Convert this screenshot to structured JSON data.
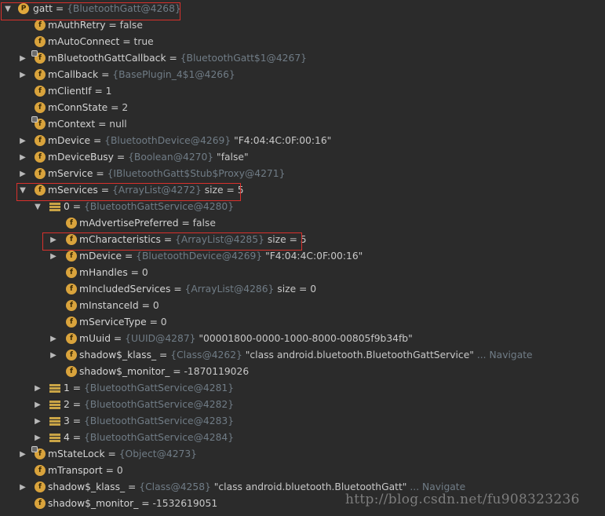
{
  "rows": [
    {
      "name": "gatt",
      "eq": " = ",
      "ref": "{BluetoothGatt@4268}",
      "val": "",
      "nav": ""
    },
    {
      "name": "mAuthRetry",
      "eq": " = ",
      "ref": "",
      "val": "false",
      "nav": ""
    },
    {
      "name": "mAutoConnect",
      "eq": " = ",
      "ref": "",
      "val": "true",
      "nav": ""
    },
    {
      "name": "mBluetoothGattCallback",
      "eq": " = ",
      "ref": "{BluetoothGatt$1@4267}",
      "val": "",
      "nav": ""
    },
    {
      "name": "mCallback",
      "eq": " = ",
      "ref": "{BasePlugin_4$1@4266}",
      "val": "",
      "nav": ""
    },
    {
      "name": "mClientIf",
      "eq": " = ",
      "ref": "",
      "val": "1",
      "nav": ""
    },
    {
      "name": "mConnState",
      "eq": " = ",
      "ref": "",
      "val": "2",
      "nav": ""
    },
    {
      "name": "mContext",
      "eq": " = ",
      "ref": "",
      "val": "null",
      "nav": ""
    },
    {
      "name": "mDevice",
      "eq": " = ",
      "ref": "{BluetoothDevice@4269}",
      "val": " \"F4:04:4C:0F:00:16\"",
      "nav": ""
    },
    {
      "name": "mDeviceBusy",
      "eq": " = ",
      "ref": "{Boolean@4270}",
      "val": " \"false\"",
      "nav": ""
    },
    {
      "name": "mService",
      "eq": " = ",
      "ref": "{IBluetoothGatt$Stub$Proxy@4271}",
      "val": "",
      "nav": ""
    },
    {
      "name": "mServices",
      "eq": " = ",
      "ref": "{ArrayList@4272}",
      "val": "  size = 5",
      "nav": ""
    },
    {
      "name": "0",
      "eq": " = ",
      "ref": "{BluetoothGattService@4280}",
      "val": "",
      "nav": ""
    },
    {
      "name": "mAdvertisePreferred",
      "eq": " = ",
      "ref": "",
      "val": "false",
      "nav": ""
    },
    {
      "name": "mCharacteristics",
      "eq": " = ",
      "ref": "{ArrayList@4285}",
      "val": "  size = 5",
      "nav": ""
    },
    {
      "name": "mDevice",
      "eq": " = ",
      "ref": "{BluetoothDevice@4269}",
      "val": " \"F4:04:4C:0F:00:16\"",
      "nav": ""
    },
    {
      "name": "mHandles",
      "eq": " = ",
      "ref": "",
      "val": "0",
      "nav": ""
    },
    {
      "name": "mIncludedServices",
      "eq": " = ",
      "ref": "{ArrayList@4286}",
      "val": "  size = 0",
      "nav": ""
    },
    {
      "name": "mInstanceId",
      "eq": " = ",
      "ref": "",
      "val": "0",
      "nav": ""
    },
    {
      "name": "mServiceType",
      "eq": " = ",
      "ref": "",
      "val": "0",
      "nav": ""
    },
    {
      "name": "mUuid",
      "eq": " = ",
      "ref": "{UUID@4287}",
      "val": " \"00001800-0000-1000-8000-00805f9b34fb\"",
      "nav": ""
    },
    {
      "name": "shadow$_klass_",
      "eq": " = ",
      "ref": "{Class@4262}",
      "val": " \"class android.bluetooth.BluetoothGattService\"",
      "nav": " ... Navigate"
    },
    {
      "name": "shadow$_monitor_",
      "eq": " = ",
      "ref": "",
      "val": "-1870119026",
      "nav": ""
    },
    {
      "name": "1",
      "eq": " = ",
      "ref": "{BluetoothGattService@4281}",
      "val": "",
      "nav": ""
    },
    {
      "name": "2",
      "eq": " = ",
      "ref": "{BluetoothGattService@4282}",
      "val": "",
      "nav": ""
    },
    {
      "name": "3",
      "eq": " = ",
      "ref": "{BluetoothGattService@4283}",
      "val": "",
      "nav": ""
    },
    {
      "name": "4",
      "eq": " = ",
      "ref": "{BluetoothGattService@4284}",
      "val": "",
      "nav": ""
    },
    {
      "name": "mStateLock",
      "eq": " = ",
      "ref": "{Object@4273}",
      "val": "",
      "nav": ""
    },
    {
      "name": "mTransport",
      "eq": " = ",
      "ref": "",
      "val": "0",
      "nav": ""
    },
    {
      "name": "shadow$_klass_",
      "eq": " = ",
      "ref": "{Class@4258}",
      "val": " \"class android.bluetooth.BluetoothGatt\"",
      "nav": " ... Navigate"
    },
    {
      "name": "shadow$_monitor_",
      "eq": " = ",
      "ref": "",
      "val": "-1532619051",
      "nav": ""
    }
  ],
  "icons": {
    "arrow_expanded": "▼",
    "arrow_collapsed": "▶",
    "property_letter": "P",
    "field_letter": "f"
  },
  "watermark": "http://blog.csdn.net/fu908323236",
  "colors": {
    "background": "#2b2b2b",
    "highlight_box": "#d8312c",
    "field_icon": "#d9a33c"
  }
}
